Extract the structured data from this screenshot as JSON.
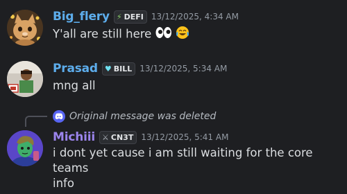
{
  "messages": [
    {
      "username": "Big_flery",
      "username_color": "#5dadec",
      "tag_icon": "lightning-icon",
      "tag": "DEFI",
      "timestamp": "13/12/2025, 4:34 AM",
      "content": "Y'all are still here",
      "emojis": [
        "eyes-emoji",
        "tears-of-joy-emoji"
      ]
    },
    {
      "username": "Prasad",
      "username_color": "#5dadec",
      "tag_icon": "heart-icon",
      "tag": "BILL",
      "timestamp": "13/12/2025, 5:34 AM",
      "content": "mng all"
    },
    {
      "reply": {
        "icon": "discord-icon",
        "text": "Original message was deleted"
      },
      "username": "Michiii",
      "username_color": "#9b84ec",
      "tag_icon": "sword-icon",
      "tag": "CN3T",
      "timestamp": "13/12/2025, 5:41 AM",
      "content_lines": [
        "i dont yet cause i am still waiting for the core teams",
        "info"
      ]
    }
  ]
}
